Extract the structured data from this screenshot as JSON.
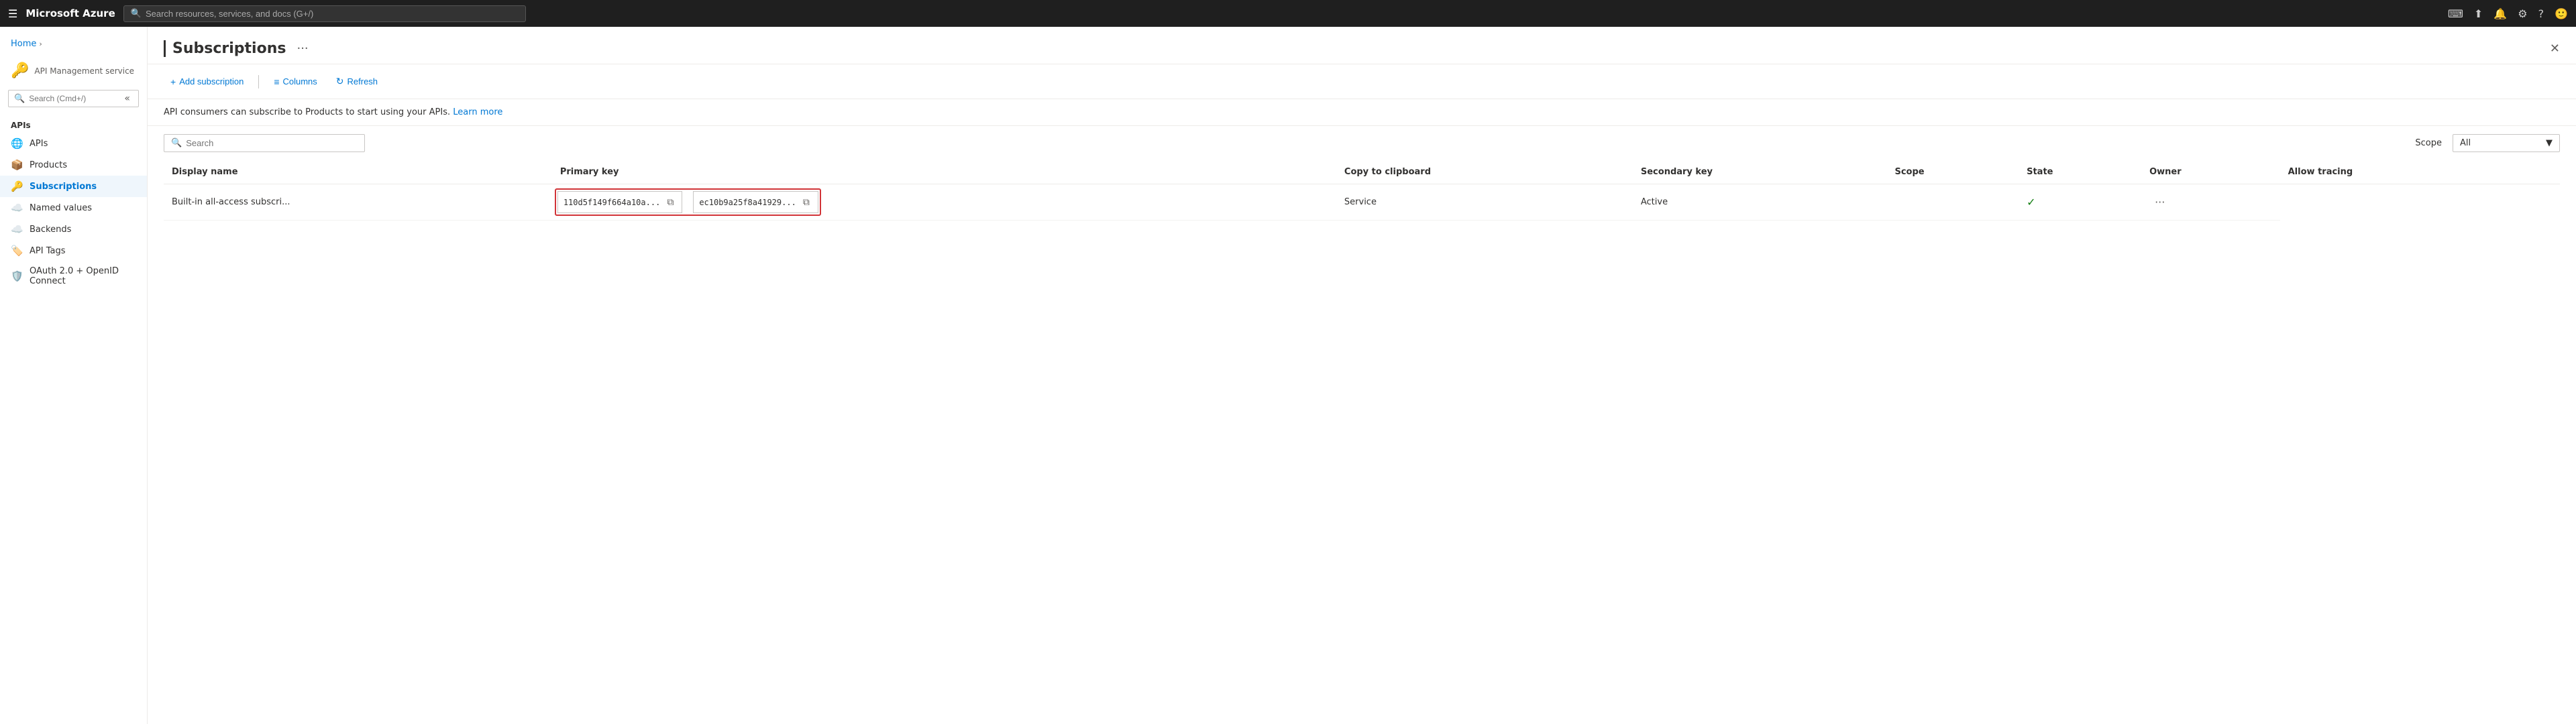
{
  "topNav": {
    "hamburger": "☰",
    "title": "Microsoft Azure",
    "searchPlaceholder": "Search resources, services, and docs (G+/)"
  },
  "breadcrumb": {
    "home": "Home"
  },
  "sidebar": {
    "serviceIcon": "🔑",
    "serviceName": "API Management service",
    "searchPlaceholder": "Search (Cmd+/)",
    "collapseLabel": "«",
    "sections": [
      {
        "label": "APIs",
        "items": [
          {
            "id": "apis",
            "label": "APIs",
            "icon": "🌐",
            "active": false
          },
          {
            "id": "products",
            "label": "Products",
            "icon": "📦",
            "active": false
          },
          {
            "id": "subscriptions",
            "label": "Subscriptions",
            "icon": "🔑",
            "active": true
          },
          {
            "id": "named-values",
            "label": "Named values",
            "icon": "☁️",
            "active": false
          },
          {
            "id": "backends",
            "label": "Backends",
            "icon": "☁️",
            "active": false
          },
          {
            "id": "api-tags",
            "label": "API Tags",
            "icon": "🏷️",
            "active": false
          },
          {
            "id": "oauth",
            "label": "OAuth 2.0 + OpenID Connect",
            "icon": "🛡️",
            "active": false
          }
        ]
      }
    ]
  },
  "page": {
    "title": "Subscriptions",
    "ellipsisLabel": "···",
    "closeLabel": "✕"
  },
  "toolbar": {
    "addSubscription": "Add subscription",
    "columns": "Columns",
    "refresh": "Refresh",
    "addIcon": "+",
    "columnsIcon": "≡",
    "refreshIcon": "↻"
  },
  "infoBar": {
    "text": "API consumers can subscribe to Products to start using your APIs.",
    "linkText": "Learn more"
  },
  "filterBar": {
    "searchPlaceholder": "Search",
    "scopeLabel": "Scope",
    "scopeValue": "All"
  },
  "table": {
    "columns": [
      {
        "id": "display-name",
        "label": "Display name"
      },
      {
        "id": "primary-key",
        "label": "Primary key"
      },
      {
        "id": "copy-tooltip",
        "label": "Copy to clipboard"
      },
      {
        "id": "secondary-key",
        "label": "Secondary key"
      },
      {
        "id": "scope",
        "label": "Scope"
      },
      {
        "id": "state",
        "label": "State"
      },
      {
        "id": "owner",
        "label": "Owner"
      },
      {
        "id": "allow-tracing",
        "label": "Allow tracing"
      }
    ],
    "rows": [
      {
        "displayName": "Built-in all-access subscri...",
        "primaryKey": "110d5f149f664a10a...",
        "secondaryKey": "ec10b9a25f8a41929...",
        "scope": "Service",
        "state": "Active",
        "owner": "",
        "allowTracing": "✓"
      }
    ]
  }
}
